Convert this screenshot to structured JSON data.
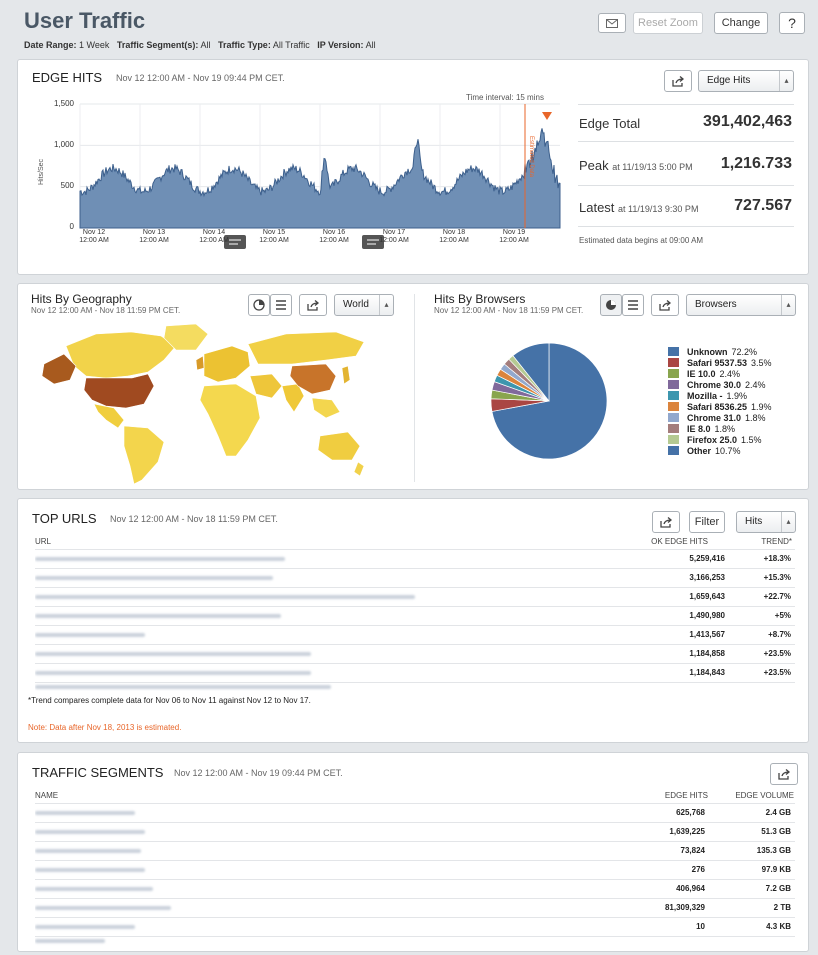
{
  "header": {
    "title": "User Traffic",
    "filters": [
      {
        "label": "Date Range:",
        "value": "1 Week"
      },
      {
        "label": "Traffic Segment(s):",
        "value": "All"
      },
      {
        "label": "Traffic Type:",
        "value": "All Traffic"
      },
      {
        "label": "IP Version:",
        "value": "All"
      }
    ],
    "reset_zoom": "Reset Zoom",
    "change": "Change",
    "help": "?"
  },
  "edge_hits": {
    "title": "EDGE HITS",
    "range": "Nov 12 12:00 AM - Nov 19 09:44 PM CET.",
    "select": "Edge Hits",
    "interval": "Time interval: 15 mins",
    "estimated_label": "Estimated Data",
    "ylabel": "Hits/Sec",
    "yticks": [
      "1,500",
      "1,000",
      "500",
      "0"
    ],
    "xticks": [
      [
        "Nov 12",
        "12:00 AM"
      ],
      [
        "Nov 13",
        "12:00 AM"
      ],
      [
        "Nov 14",
        "12:00 AM"
      ],
      [
        "Nov 15",
        "12:00 AM"
      ],
      [
        "Nov 16",
        "12:00 AM"
      ],
      [
        "Nov 17",
        "12:00 AM"
      ],
      [
        "Nov 18",
        "12:00 AM"
      ],
      [
        "Nov 19",
        "12:00 AM"
      ]
    ],
    "stats": {
      "total_label": "Edge Total",
      "total_value": "391,402,463",
      "peak_label": "Peak",
      "peak_at": "at 11/19/13 5:00 PM",
      "peak_value": "1,216.733",
      "latest_label": "Latest",
      "latest_at": "at 11/19/13 9:30 PM",
      "latest_value": "727.567",
      "note": "Estimated data begins at 09:00 AM"
    },
    "colors": {
      "fill": "#6f8fb5",
      "line": "#3c5f8c",
      "estimate": "#e8662a"
    }
  },
  "geography": {
    "title": "Hits By Geography",
    "range": "Nov 12 12:00 AM - Nov 18 11:59 PM CET.",
    "select": "World"
  },
  "browsers": {
    "title": "Hits By Browsers",
    "range": "Nov 12 12:00 AM - Nov 18 11:59 PM CET.",
    "select": "Browsers",
    "items": [
      {
        "name": "Unknown",
        "pct": "72.2%",
        "value": 72.2,
        "color": "#4572a7"
      },
      {
        "name": "Safari 9537.53",
        "pct": "3.5%",
        "value": 3.5,
        "color": "#aa4643"
      },
      {
        "name": "IE 10.0",
        "pct": "2.4%",
        "value": 2.4,
        "color": "#89a54e"
      },
      {
        "name": "Chrome 30.0",
        "pct": "2.4%",
        "value": 2.4,
        "color": "#80699b"
      },
      {
        "name": "Mozilla -",
        "pct": "1.9%",
        "value": 1.9,
        "color": "#3d96ae"
      },
      {
        "name": "Safari 8536.25",
        "pct": "1.9%",
        "value": 1.9,
        "color": "#db843d"
      },
      {
        "name": "Chrome 31.0",
        "pct": "1.8%",
        "value": 1.8,
        "color": "#92a8cd"
      },
      {
        "name": "IE 8.0",
        "pct": "1.8%",
        "value": 1.8,
        "color": "#a47d7c"
      },
      {
        "name": "Firefox 25.0",
        "pct": "1.5%",
        "value": 1.5,
        "color": "#b5ca92"
      },
      {
        "name": "Other",
        "pct": "10.7%",
        "value": 10.7,
        "color": "#4572a7"
      }
    ]
  },
  "top_urls": {
    "title": "TOP URLS",
    "range": "Nov 12 12:00 AM - Nov 18 11:59 PM CET.",
    "filter": "Filter",
    "select": "Hits",
    "col_url": "URL",
    "col_hits": "OK EDGE HITS",
    "col_trend": "TREND*",
    "rows": [
      {
        "hits": "5,259,416",
        "trend": "+18.3%"
      },
      {
        "hits": "3,166,253",
        "trend": "+15.3%"
      },
      {
        "hits": "1,659,643",
        "trend": "+22.7%"
      },
      {
        "hits": "1,490,980",
        "trend": "+5%"
      },
      {
        "hits": "1,413,567",
        "trend": "+8.7%"
      },
      {
        "hits": "1,184,858",
        "trend": "+23.5%"
      },
      {
        "hits": "1,184,843",
        "trend": "+23.5%"
      }
    ],
    "footnote": "*Trend compares complete data for Nov 06 to Nov 11 against Nov 12 to Nov 17.",
    "note": "Note: Data after Nov 18, 2013 is estimated."
  },
  "segments": {
    "title": "TRAFFIC SEGMENTS",
    "range": "Nov 12 12:00 AM - Nov 19 09:44 PM CET.",
    "col_name": "NAME",
    "col_hits": "EDGE HITS",
    "col_volume": "EDGE VOLUME",
    "rows": [
      {
        "hits": "625,768",
        "volume": "2.4 GB"
      },
      {
        "hits": "1,639,225",
        "volume": "51.3 GB"
      },
      {
        "hits": "73,824",
        "volume": "135.3 GB"
      },
      {
        "hits": "276",
        "volume": "97.9 KB"
      },
      {
        "hits": "406,964",
        "volume": "7.2 GB"
      },
      {
        "hits": "81,309,329",
        "volume": "2 TB"
      },
      {
        "hits": "10",
        "volume": "4.3 KB"
      }
    ]
  }
}
